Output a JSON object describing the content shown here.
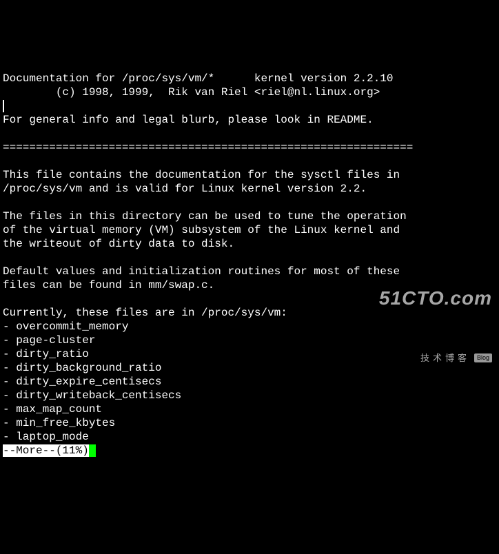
{
  "doc": {
    "line1": "Documentation for /proc/sys/vm/*      kernel version 2.2.10",
    "line2": "        (c) 1998, 1999,  Rik van Riel <riel@nl.linux.org>",
    "blank1": "",
    "intro": "For general info and legal blurb, please look in README.",
    "blank2": "",
    "divider": "==============================================================",
    "blank3": "",
    "p1a": "This file contains the documentation for the sysctl files in",
    "p1b": "/proc/sys/vm and is valid for Linux kernel version 2.2.",
    "blank4": "",
    "p2a": "The files in this directory can be used to tune the operation",
    "p2b": "of the virtual memory (VM) subsystem of the Linux kernel and",
    "p2c": "the writeout of dirty data to disk.",
    "blank5": "",
    "p3a": "Default values and initialization routines for most of these",
    "p3b": "files can be found in mm/swap.c.",
    "blank6": "",
    "listhead": "Currently, these files are in /proc/sys/vm:",
    "item1": "- overcommit_memory",
    "item2": "- page-cluster",
    "item3": "- dirty_ratio",
    "item4": "- dirty_background_ratio",
    "item5": "- dirty_expire_centisecs",
    "item6": "- dirty_writeback_centisecs",
    "item7": "- max_map_count",
    "item8": "- min_free_kbytes",
    "item9": "- laptop_mode"
  },
  "more": "--More--(11%)",
  "watermark": {
    "main": "51CTO.com",
    "sub": "技术博客",
    "blog": "Blog"
  }
}
